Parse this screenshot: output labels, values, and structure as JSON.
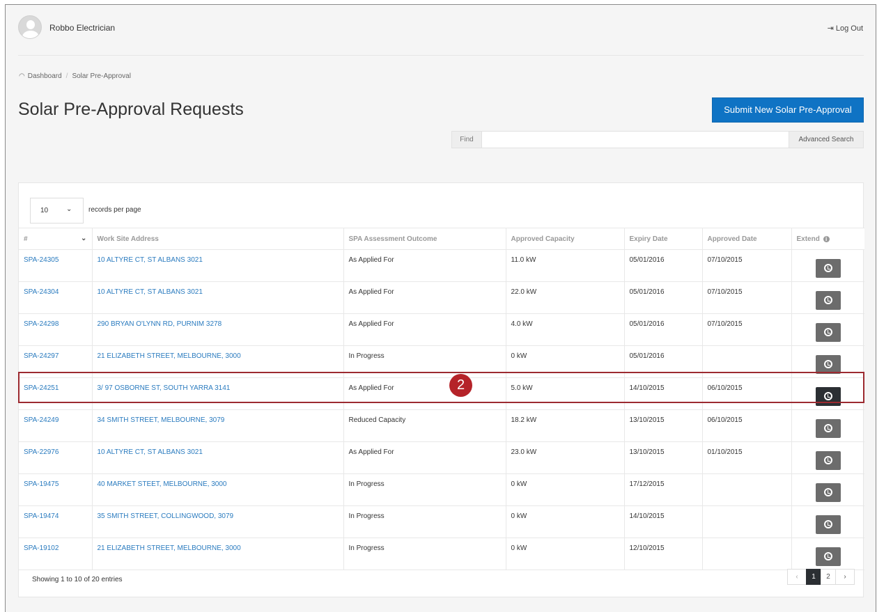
{
  "header": {
    "username": "Robbo Electrician",
    "logout_label": "Log Out",
    "logout_icon": "logout-icon"
  },
  "breadcrumb": {
    "icon": "dashboard-gauge-icon",
    "items": [
      "Dashboard",
      "Solar Pre-Approval"
    ],
    "divider": "/"
  },
  "page": {
    "title": "Solar Pre-Approval Requests",
    "submit_label": "Submit New Solar Pre-Approval"
  },
  "search": {
    "find_label": "Find",
    "value": "",
    "advanced_label": "Advanced Search"
  },
  "records": {
    "per_page_value": "10",
    "per_page_label": "records per page"
  },
  "table": {
    "columns": [
      "#",
      "Work Site Address",
      "SPA Assessment Outcome",
      "Approved Capacity",
      "Expiry Date",
      "Approved Date",
      "Extend"
    ],
    "rows": [
      {
        "id": "SPA-24305",
        "address": "10 ALTYRE CT, ST ALBANS 3021",
        "outcome": "As Applied For",
        "capacity": "11.0 kW",
        "expiry": "05/01/2016",
        "approved": "07/10/2015"
      },
      {
        "id": "SPA-24304",
        "address": "10 ALTYRE CT, ST ALBANS 3021",
        "outcome": "As Applied For",
        "capacity": "22.0 kW",
        "expiry": "05/01/2016",
        "approved": "07/10/2015"
      },
      {
        "id": "SPA-24298",
        "address": "290 BRYAN O'LYNN RD, PURNIM 3278",
        "outcome": "As Applied For",
        "capacity": "4.0 kW",
        "expiry": "05/01/2016",
        "approved": "07/10/2015"
      },
      {
        "id": "SPA-24297",
        "address": "21 ELIZABETH STREET, MELBOURNE, 3000",
        "outcome": "In Progress",
        "capacity": "0 kW",
        "expiry": "05/01/2016",
        "approved": ""
      },
      {
        "id": "SPA-24251",
        "address": "3/ 97 OSBORNE ST, SOUTH YARRA 3141",
        "outcome": "As Applied For",
        "capacity": "5.0 kW",
        "expiry": "14/10/2015",
        "approved": "06/10/2015"
      },
      {
        "id": "SPA-24249",
        "address": "34 SMITH STREET, MELBOURNE, 3079",
        "outcome": "Reduced Capacity",
        "capacity": "18.2 kW",
        "expiry": "13/10/2015",
        "approved": "06/10/2015"
      },
      {
        "id": "SPA-22976",
        "address": "10 ALTYRE CT, ST ALBANS 3021",
        "outcome": "As Applied For",
        "capacity": "23.0 kW",
        "expiry": "13/10/2015",
        "approved": "01/10/2015"
      },
      {
        "id": "SPA-19475",
        "address": "40 MARKET STEET, MELBOURNE, 3000",
        "outcome": "In Progress",
        "capacity": "0 kW",
        "expiry": "17/12/2015",
        "approved": ""
      },
      {
        "id": "SPA-19474",
        "address": "35 SMITH STREET, COLLINGWOOD, 3079",
        "outcome": "In Progress",
        "capacity": "0 kW",
        "expiry": "14/10/2015",
        "approved": ""
      },
      {
        "id": "SPA-19102",
        "address": "21 ELIZABETH STREET, MELBOURNE, 3000",
        "outcome": "In Progress",
        "capacity": "0 kW",
        "expiry": "12/10/2015",
        "approved": ""
      }
    ],
    "extend_icon": "clock-icon"
  },
  "annotation": {
    "step_number": "2",
    "highlight_color": "#9c2a30",
    "badge_color": "#b52329"
  },
  "footer": {
    "info": "Showing 1 to 10 of 20 entries",
    "pages": [
      "1",
      "2"
    ],
    "prev": "‹",
    "next": "›",
    "active_page": "1"
  },
  "colors": {
    "primary": "#0f73c4",
    "link": "#2a7bbf",
    "extend_button": "#6c6c6c",
    "extend_button_active": "#2b2f33"
  }
}
